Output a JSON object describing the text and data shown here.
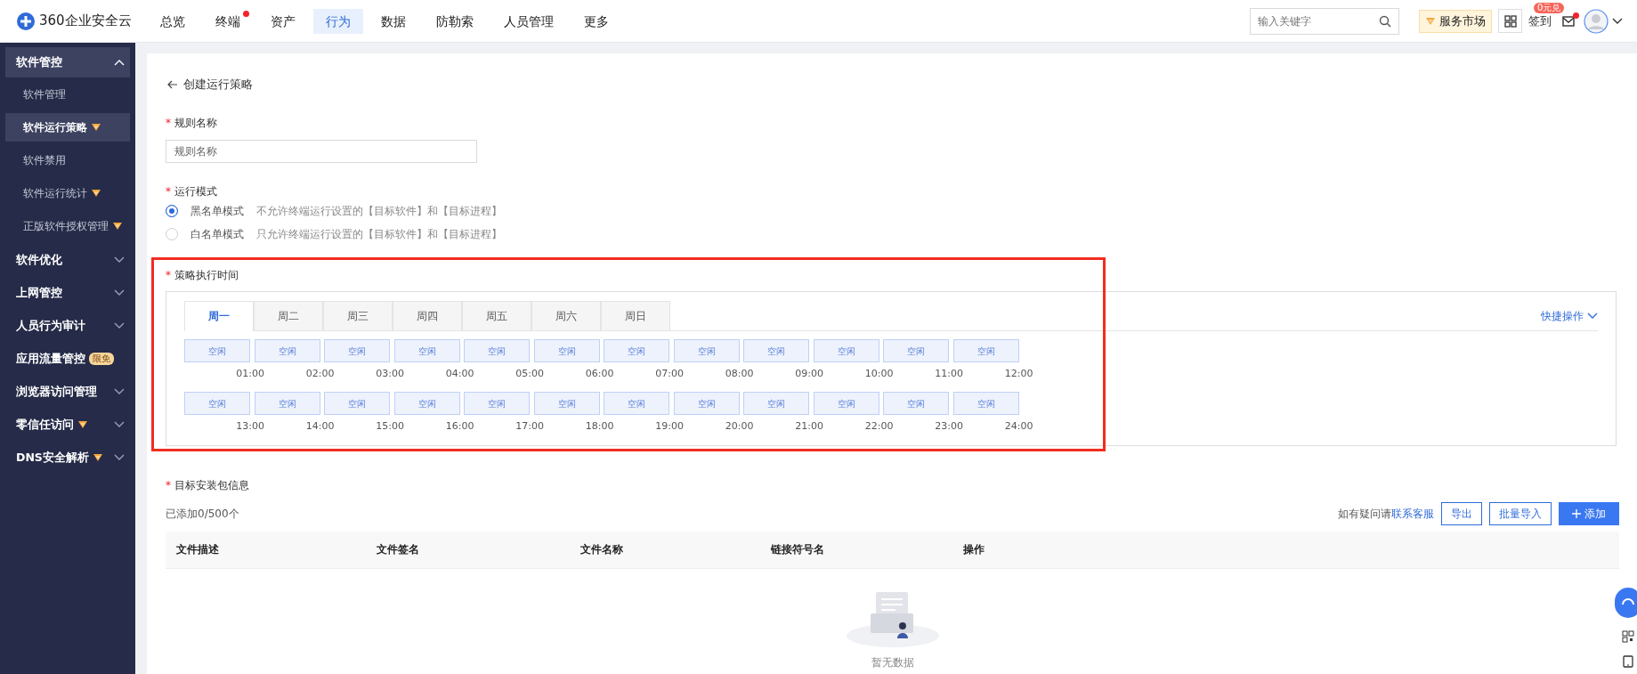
{
  "header": {
    "logo": "360企业安全云",
    "nav": [
      {
        "label": "总览",
        "selected": false,
        "notification": false
      },
      {
        "label": "终端",
        "selected": false,
        "notification": true
      },
      {
        "label": "资产",
        "selected": false,
        "notification": false
      },
      {
        "label": "行为",
        "selected": true,
        "notification": false
      },
      {
        "label": "数据",
        "selected": false,
        "notification": false
      },
      {
        "label": "防勒索",
        "selected": false,
        "notification": false
      },
      {
        "label": "人员管理",
        "selected": false,
        "notification": false
      },
      {
        "label": "更多",
        "selected": false,
        "notification": false
      }
    ],
    "search": {
      "placeholder": "输入关键字"
    },
    "market": "服务市场",
    "checkin": "签到",
    "checkin_badge": "0元兑",
    "mail_notification": true
  },
  "sidebar": {
    "items": [
      {
        "label": "软件管控",
        "expanded": true,
        "premium": false,
        "children": [
          {
            "label": "软件管理",
            "selected": false,
            "premium": false
          },
          {
            "label": "软件运行策略",
            "selected": true,
            "premium": true
          },
          {
            "label": "软件禁用",
            "selected": false,
            "premium": false
          },
          {
            "label": "软件运行统计",
            "selected": false,
            "premium": true
          },
          {
            "label": "正版软件授权管理",
            "selected": false,
            "premium": true
          }
        ]
      },
      {
        "label": "软件优化",
        "expanded": false,
        "premium": false
      },
      {
        "label": "上网管控",
        "expanded": false,
        "premium": false
      },
      {
        "label": "人员行为审计",
        "expanded": false,
        "premium": false
      },
      {
        "label": "应用流量管控",
        "expanded": false,
        "premium": false,
        "tag": "限免"
      },
      {
        "label": "浏览器访问管理",
        "expanded": false,
        "premium": false
      },
      {
        "label": "零信任访问",
        "expanded": false,
        "premium": true
      },
      {
        "label": "DNS安全解析",
        "expanded": false,
        "premium": true
      }
    ]
  },
  "page": {
    "title": "创建运行策略",
    "rule_name": {
      "label": "规则名称",
      "required_mark": "*",
      "placeholder": "规则名称"
    },
    "run_mode": {
      "label": "运行模式",
      "required_mark": "*",
      "options": [
        {
          "label": "黑名单模式",
          "description": "不允许终端运行设置的【目标软件】和【目标进程】",
          "selected": true
        },
        {
          "label": "白名单模式",
          "description": "只允许终端运行设置的【目标软件】和【目标进程】",
          "selected": false
        }
      ]
    },
    "schedule": {
      "label": "策略执行时间",
      "required_mark": "*",
      "highlighted": true,
      "tabs": [
        {
          "label": "周一",
          "selected": true
        },
        {
          "label": "周二",
          "selected": false
        },
        {
          "label": "周三",
          "selected": false
        },
        {
          "label": "周四",
          "selected": false
        },
        {
          "label": "周五",
          "selected": false
        },
        {
          "label": "周六",
          "selected": false
        },
        {
          "label": "周日",
          "selected": false
        }
      ],
      "quick_action": "快捷操作",
      "slots": [
        {
          "label": "空闲",
          "time": "01:00"
        },
        {
          "label": "空闲",
          "time": "02:00"
        },
        {
          "label": "空闲",
          "time": "03:00"
        },
        {
          "label": "空闲",
          "time": "04:00"
        },
        {
          "label": "空闲",
          "time": "05:00"
        },
        {
          "label": "空闲",
          "time": "06:00"
        },
        {
          "label": "空闲",
          "time": "07:00"
        },
        {
          "label": "空闲",
          "time": "08:00"
        },
        {
          "label": "空闲",
          "time": "09:00"
        },
        {
          "label": "空闲",
          "time": "10:00"
        },
        {
          "label": "空闲",
          "time": "11:00"
        },
        {
          "label": "空闲",
          "time": "12:00"
        },
        {
          "label": "空闲",
          "time": "13:00"
        },
        {
          "label": "空闲",
          "time": "14:00"
        },
        {
          "label": "空闲",
          "time": "15:00"
        },
        {
          "label": "空闲",
          "time": "16:00"
        },
        {
          "label": "空闲",
          "time": "17:00"
        },
        {
          "label": "空闲",
          "time": "18:00"
        },
        {
          "label": "空闲",
          "time": "19:00"
        },
        {
          "label": "空闲",
          "time": "20:00"
        },
        {
          "label": "空闲",
          "time": "21:00"
        },
        {
          "label": "空闲",
          "time": "22:00"
        },
        {
          "label": "空闲",
          "time": "23:00"
        },
        {
          "label": "空闲",
          "time": "24:00"
        }
      ]
    },
    "packages": {
      "label": "目标安装包信息",
      "required_mark": "*",
      "count": "已添加0/500个",
      "help_text": "如有疑问请",
      "help_link": "联系客服",
      "buttons": [
        {
          "label": "导出",
          "kind": "outline"
        },
        {
          "label": "批量导入",
          "kind": "outline"
        },
        {
          "label": "添加",
          "kind": "primary"
        }
      ],
      "table": {
        "columns": [
          "文件描述",
          "文件签名",
          "文件名称",
          "链接符号名",
          "操作"
        ],
        "empty_text": "暂无数据"
      }
    }
  }
}
